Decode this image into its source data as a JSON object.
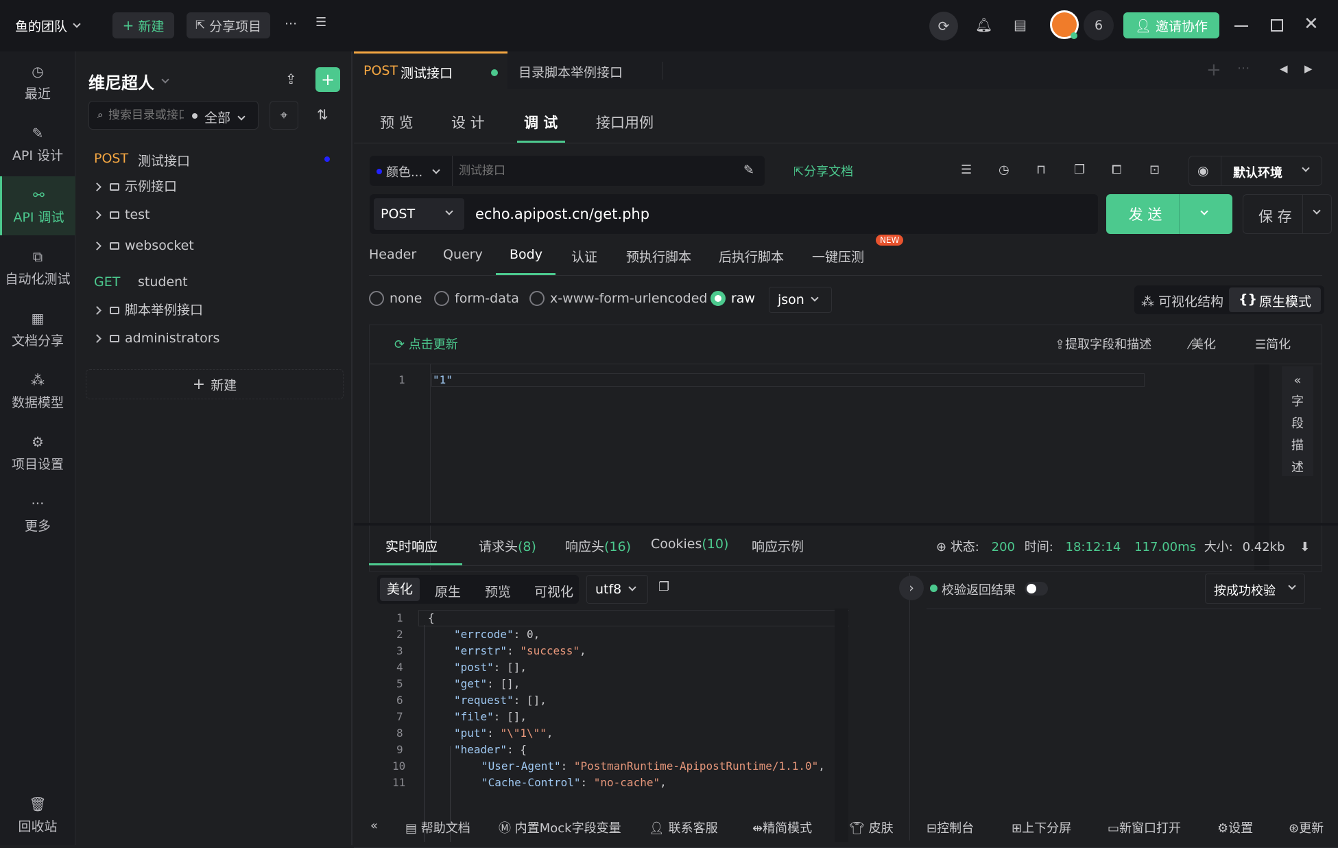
{
  "topbar": {
    "team": "鱼的团队",
    "new_label": "新建",
    "share_label": "分享项目",
    "more": "···",
    "member_count": "6",
    "invite_label": "邀请协作"
  },
  "leftnav": {
    "items": [
      {
        "label": "最近",
        "icon": "clock-icon"
      },
      {
        "label": "API 设计",
        "icon": "edit-icon"
      },
      {
        "label": "API 调试",
        "icon": "link-icon"
      },
      {
        "label": "自动化测试",
        "icon": "flow-icon"
      },
      {
        "label": "文档分享",
        "icon": "doc-icon"
      },
      {
        "label": "数据模型",
        "icon": "model-icon"
      },
      {
        "label": "项目设置",
        "icon": "settings-folder-icon"
      },
      {
        "label": "更多",
        "icon": "more-icon"
      }
    ],
    "trash": "回收站"
  },
  "tree": {
    "project": "维尼超人",
    "search_placeholder": "搜索目录或接口",
    "filter": "全部",
    "items": [
      {
        "method": "POST",
        "name": "测试接口",
        "type": "api"
      },
      {
        "name": "示例接口",
        "type": "folder"
      },
      {
        "name": "test",
        "type": "folder"
      },
      {
        "name": "websocket",
        "type": "folder"
      },
      {
        "method": "GET",
        "name": "student",
        "type": "api"
      },
      {
        "name": "脚本举例接口",
        "type": "folder"
      },
      {
        "name": "administrators",
        "type": "folder"
      }
    ],
    "new_label": "新建"
  },
  "tabs": [
    {
      "method": "POST",
      "name": "测试接口"
    },
    {
      "name": "目录脚本举例接口"
    }
  ],
  "modes": [
    "预 览",
    "设 计",
    "调 试",
    "接口用例"
  ],
  "toolbar": {
    "color_label": "颜色...",
    "name_placeholder": "测试接口",
    "share_doc": "分享文档",
    "env": "默认环境"
  },
  "request": {
    "method": "POST",
    "url": "echo.apipost.cn/get.php",
    "send": "发 送",
    "save": "保 存"
  },
  "req_tabs": [
    "Header",
    "Query",
    "Body",
    "认证",
    "预执行脚本",
    "后执行脚本",
    "一键压测"
  ],
  "new_badge": "NEW",
  "body": {
    "types": [
      "none",
      "form-data",
      "x-www-form-urlencoded",
      "raw"
    ],
    "format": "json",
    "view_visual": "可视化结构",
    "view_raw": "原生模式",
    "refresh": "点击更新",
    "extract": "提取字段和描述",
    "beautify": "美化",
    "simplify": "简化",
    "line1": "\"1\"",
    "side_label": [
      "字",
      "段",
      "描",
      "述"
    ]
  },
  "response": {
    "tabs": {
      "live": "实时响应",
      "req_headers": "请求头",
      "req_headers_count": "(8)",
      "resp_headers": "响应头",
      "resp_headers_count": "(16)",
      "cookies": "Cookies",
      "cookies_count": "(10)",
      "example": "响应示例"
    },
    "status_label": "状态:",
    "status": "200",
    "time_label": "时间:",
    "time": "18:12:14",
    "duration": "117.00ms",
    "size_label": "大小:",
    "size": "0.42kb",
    "views": [
      "美化",
      "原生",
      "预览",
      "可视化"
    ],
    "encoding": "utf8",
    "validate_label": "校验返回结果",
    "validate_select": "按成功校验"
  },
  "bottombar": [
    "帮助文档",
    "内置Mock字段变量",
    "联系客服",
    "精简模式",
    "皮肤",
    "控制台",
    "上下分屏",
    "新窗口打开",
    "设置",
    "更新"
  ],
  "colors": {
    "accent": "#4cc98e",
    "post": "#f5a742",
    "get": "#4cc98e",
    "key": "#9ec7f0",
    "string": "#e5967a"
  }
}
